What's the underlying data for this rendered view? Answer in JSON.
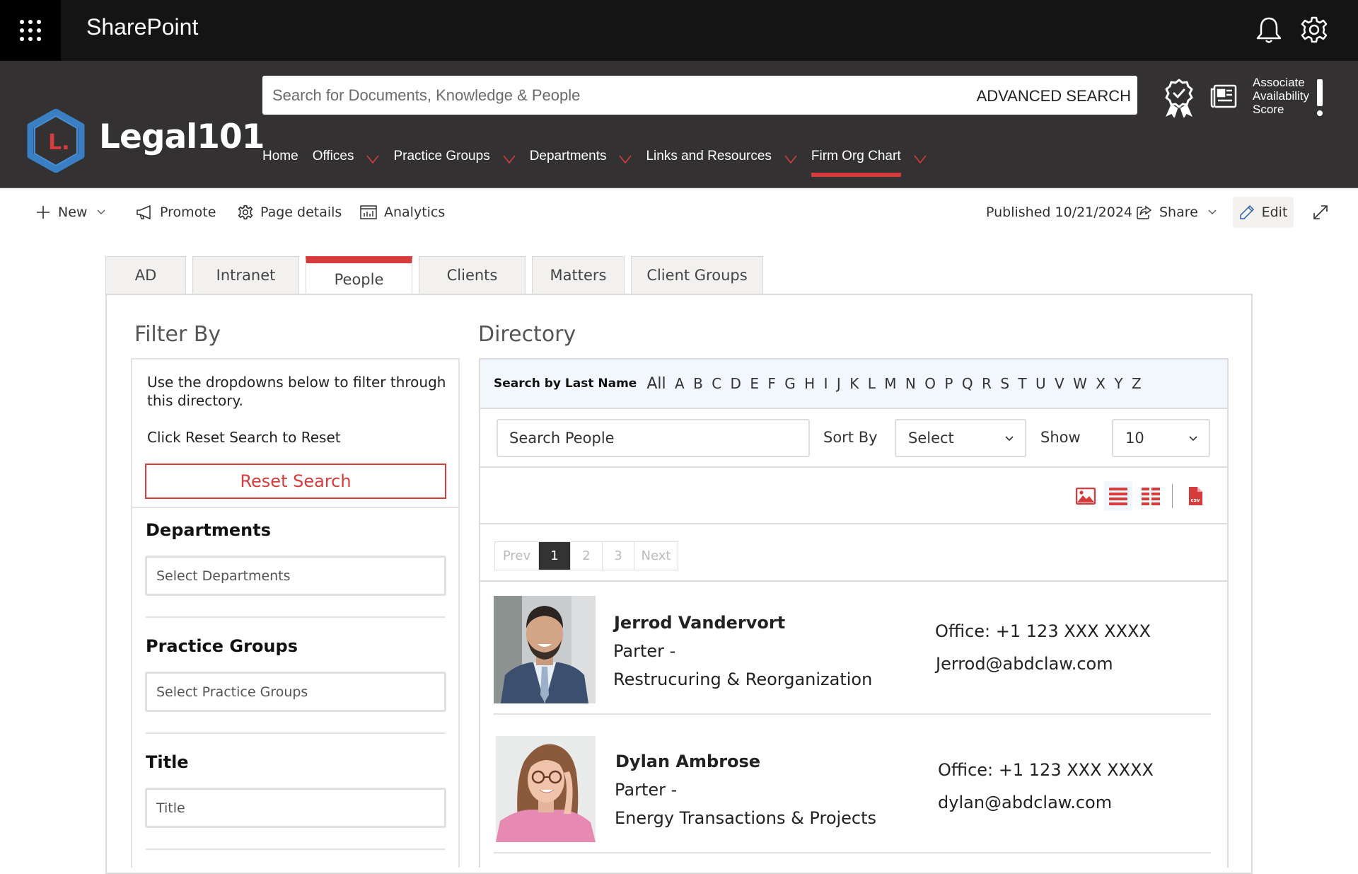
{
  "suite_bar": {
    "app_title": "SharePoint",
    "icons": [
      "waffle-icon",
      "bell-icon",
      "gear-icon"
    ]
  },
  "site_header": {
    "site_name": "Legal101",
    "logo_letter": "L.",
    "search": {
      "placeholder": "Search for Documents, Knowledge & People",
      "advanced_label": "ADVANCED SEARCH"
    },
    "associate_score": {
      "line1": "Associate",
      "line2": "Availability",
      "line3": "Score"
    },
    "nav": [
      {
        "label": "Home",
        "has_dropdown": false,
        "active": false
      },
      {
        "label": "Offices",
        "has_dropdown": true,
        "active": false
      },
      {
        "label": "Practice Groups",
        "has_dropdown": true,
        "active": false
      },
      {
        "label": "Departments",
        "has_dropdown": true,
        "active": false
      },
      {
        "label": "Links and Resources",
        "has_dropdown": true,
        "active": false
      },
      {
        "label": "Firm Org Chart",
        "has_dropdown": true,
        "active": true
      }
    ]
  },
  "command_bar": {
    "new_label": "New",
    "promote_label": "Promote",
    "page_details_label": "Page details",
    "analytics_label": "Analytics",
    "published": "Published 10/21/2024",
    "share_label": "Share",
    "edit_label": "Edit"
  },
  "tabs": [
    {
      "label": "AD",
      "active": false
    },
    {
      "label": "Intranet",
      "active": false
    },
    {
      "label": "People",
      "active": true
    },
    {
      "label": "Clients",
      "active": false
    },
    {
      "label": "Matters",
      "active": false
    },
    {
      "label": "Client Groups",
      "active": false
    }
  ],
  "filter": {
    "heading": "Filter By",
    "intro": "Use the dropdowns below to filter through this directory.",
    "reset_hint": "Click Reset Search to Reset",
    "reset_button": "Reset Search",
    "fields": [
      {
        "label": "Departments",
        "placeholder": "Select Departments"
      },
      {
        "label": "Practice Groups",
        "placeholder": "Select Practice Groups"
      },
      {
        "label": "Title",
        "placeholder": "Title"
      }
    ]
  },
  "directory": {
    "heading": "Directory",
    "alpha_label": "Search by Last Name",
    "alpha": [
      "All",
      "A",
      "B",
      "C",
      "D",
      "E",
      "F",
      "G",
      "H",
      "I",
      "J",
      "K",
      "L",
      "M",
      "N",
      "O",
      "P",
      "Q",
      "R",
      "S",
      "T",
      "U",
      "V",
      "W",
      "X",
      "Y",
      "Z"
    ],
    "search_placeholder": "Search People",
    "sort_label": "Sort By",
    "sort_value": "Select",
    "show_label": "Show",
    "show_value": "10",
    "view_icons": [
      "image-view-icon",
      "list-view-icon",
      "grid-view-icon",
      "csv-export-icon"
    ],
    "active_view": "list-view-icon",
    "pagination": {
      "prev": "Prev",
      "pages": [
        "1",
        "2",
        "3"
      ],
      "current": "1",
      "next": "Next"
    },
    "people": [
      {
        "name": "Jerrod Vandervort",
        "title": "Parter -",
        "department": "Restrucuring & Reorganization",
        "phone": "Office: +1 123 XXX XXXX",
        "email": "Jerrod@abdclaw.com"
      },
      {
        "name": "Dylan Ambrose",
        "title": "Parter -",
        "department": "Energy Transactions & Projects",
        "phone": "Office: +1 123 XXX XXXX",
        "email": "dylan@abdclaw.com"
      }
    ]
  },
  "colors": {
    "accent_red": "#d63c3c",
    "logo_blue": "#3a7fc4",
    "header_dark": "#333132",
    "suite_black": "#141414",
    "alpha_bar_bg": "#f2f7fd"
  }
}
